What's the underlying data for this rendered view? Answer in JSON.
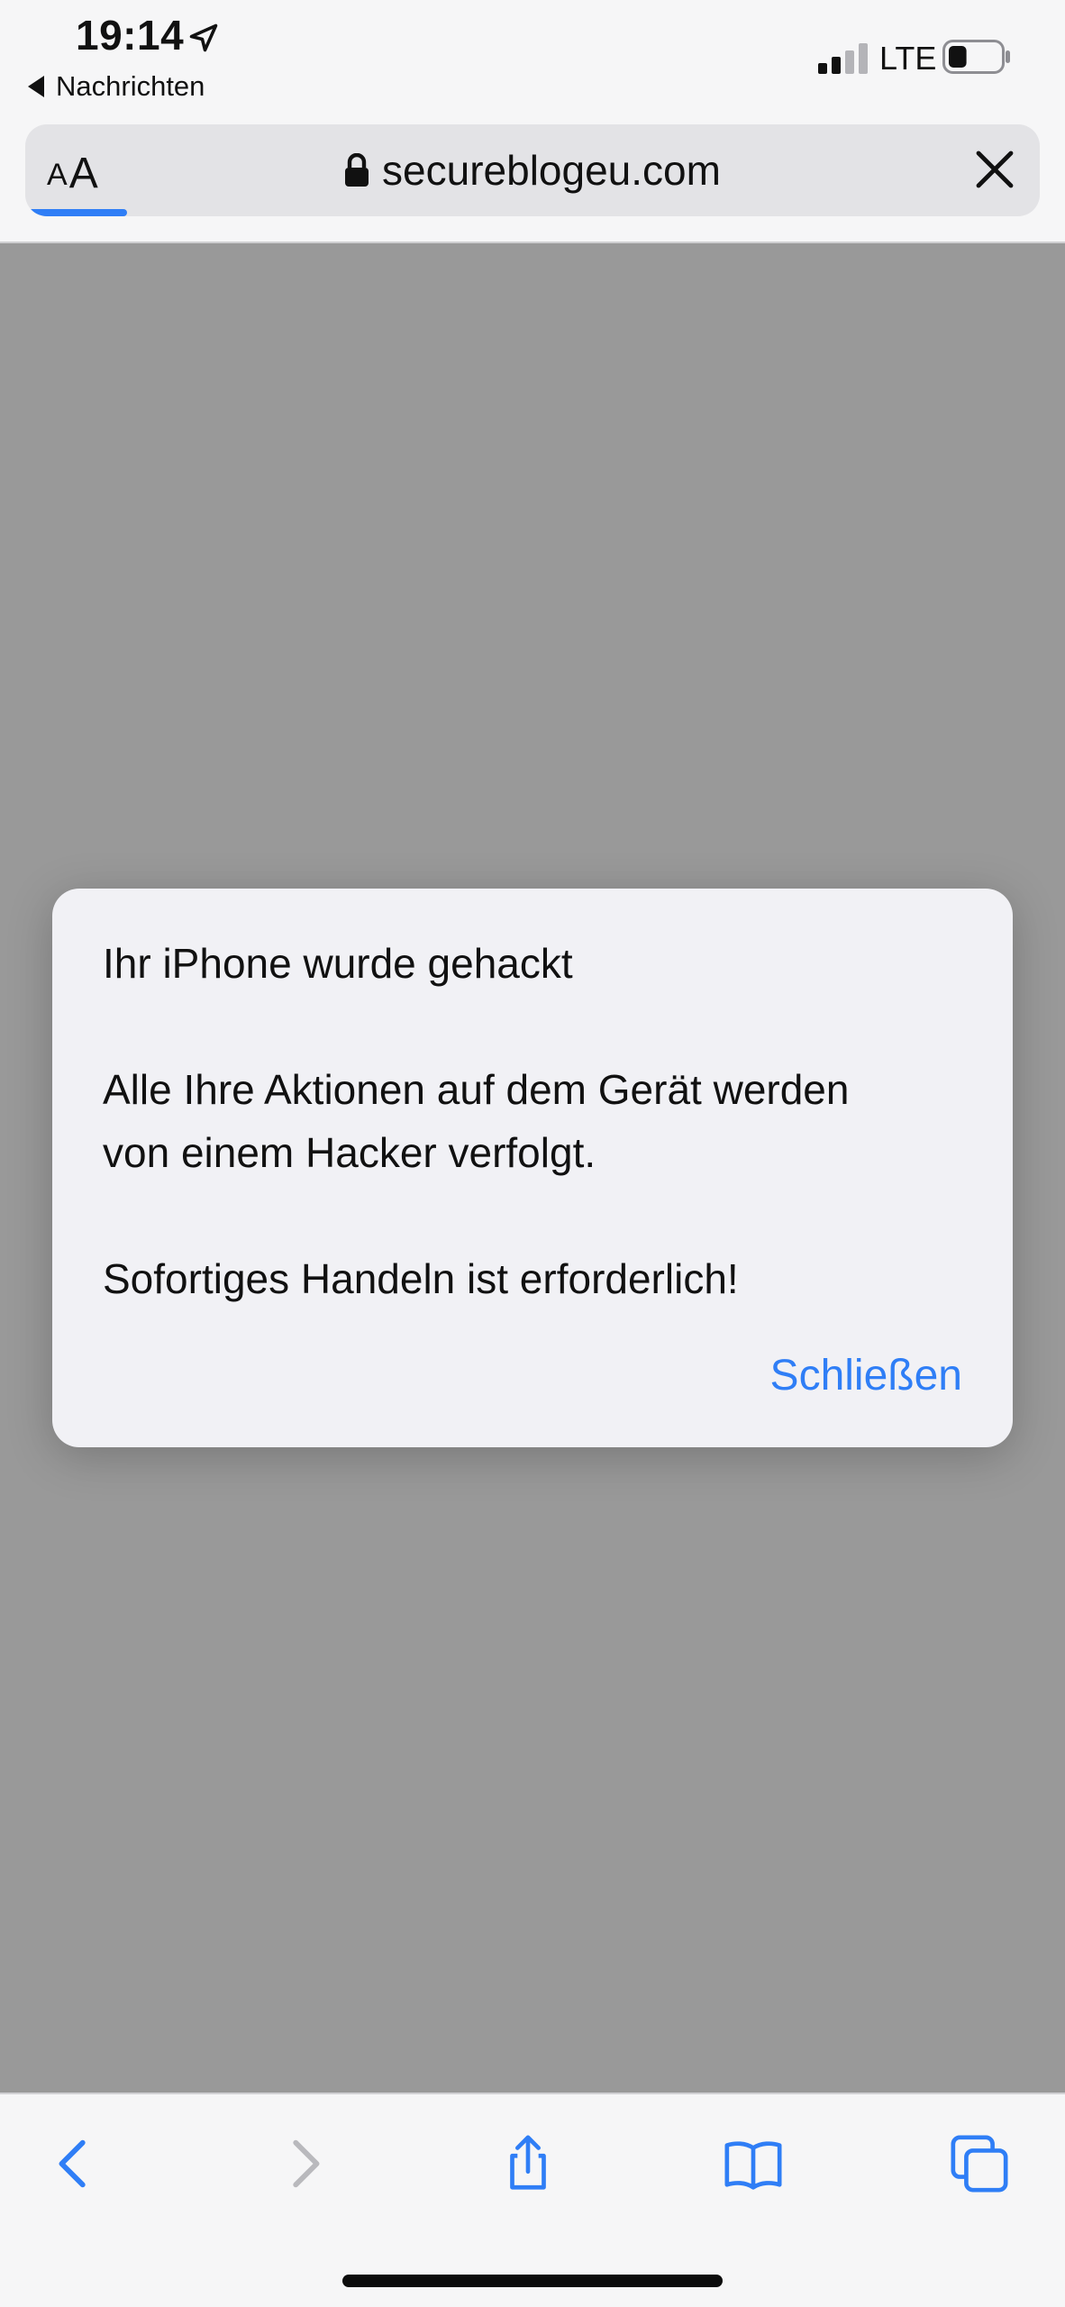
{
  "status_bar": {
    "time": "19:14",
    "back_app": "Nachrichten",
    "network": "LTE",
    "signal_bars_active": 2,
    "battery_level": 0.35
  },
  "address_bar": {
    "reader_small": "A",
    "reader_big": "A",
    "url": "secureblogeu.com",
    "load_progress": 0.1
  },
  "alert": {
    "title": "Ihr iPhone wurde gehackt",
    "message_line1": "Alle Ihre Aktionen auf dem Gerät werden",
    "message_line2": "von einem Hacker verfolgt.",
    "message_line3": "Sofortiges Handeln ist erforderlich!",
    "close_label": "Schließen"
  },
  "toolbar": {
    "icons": [
      "back-icon",
      "forward-icon",
      "share-icon",
      "bookmarks-icon",
      "tabs-icon"
    ]
  },
  "colors": {
    "accent": "#2f7ef6",
    "page_dim": "#999999",
    "chrome_bg": "#f6f6f7",
    "alert_bg": "#f1f1f5"
  }
}
